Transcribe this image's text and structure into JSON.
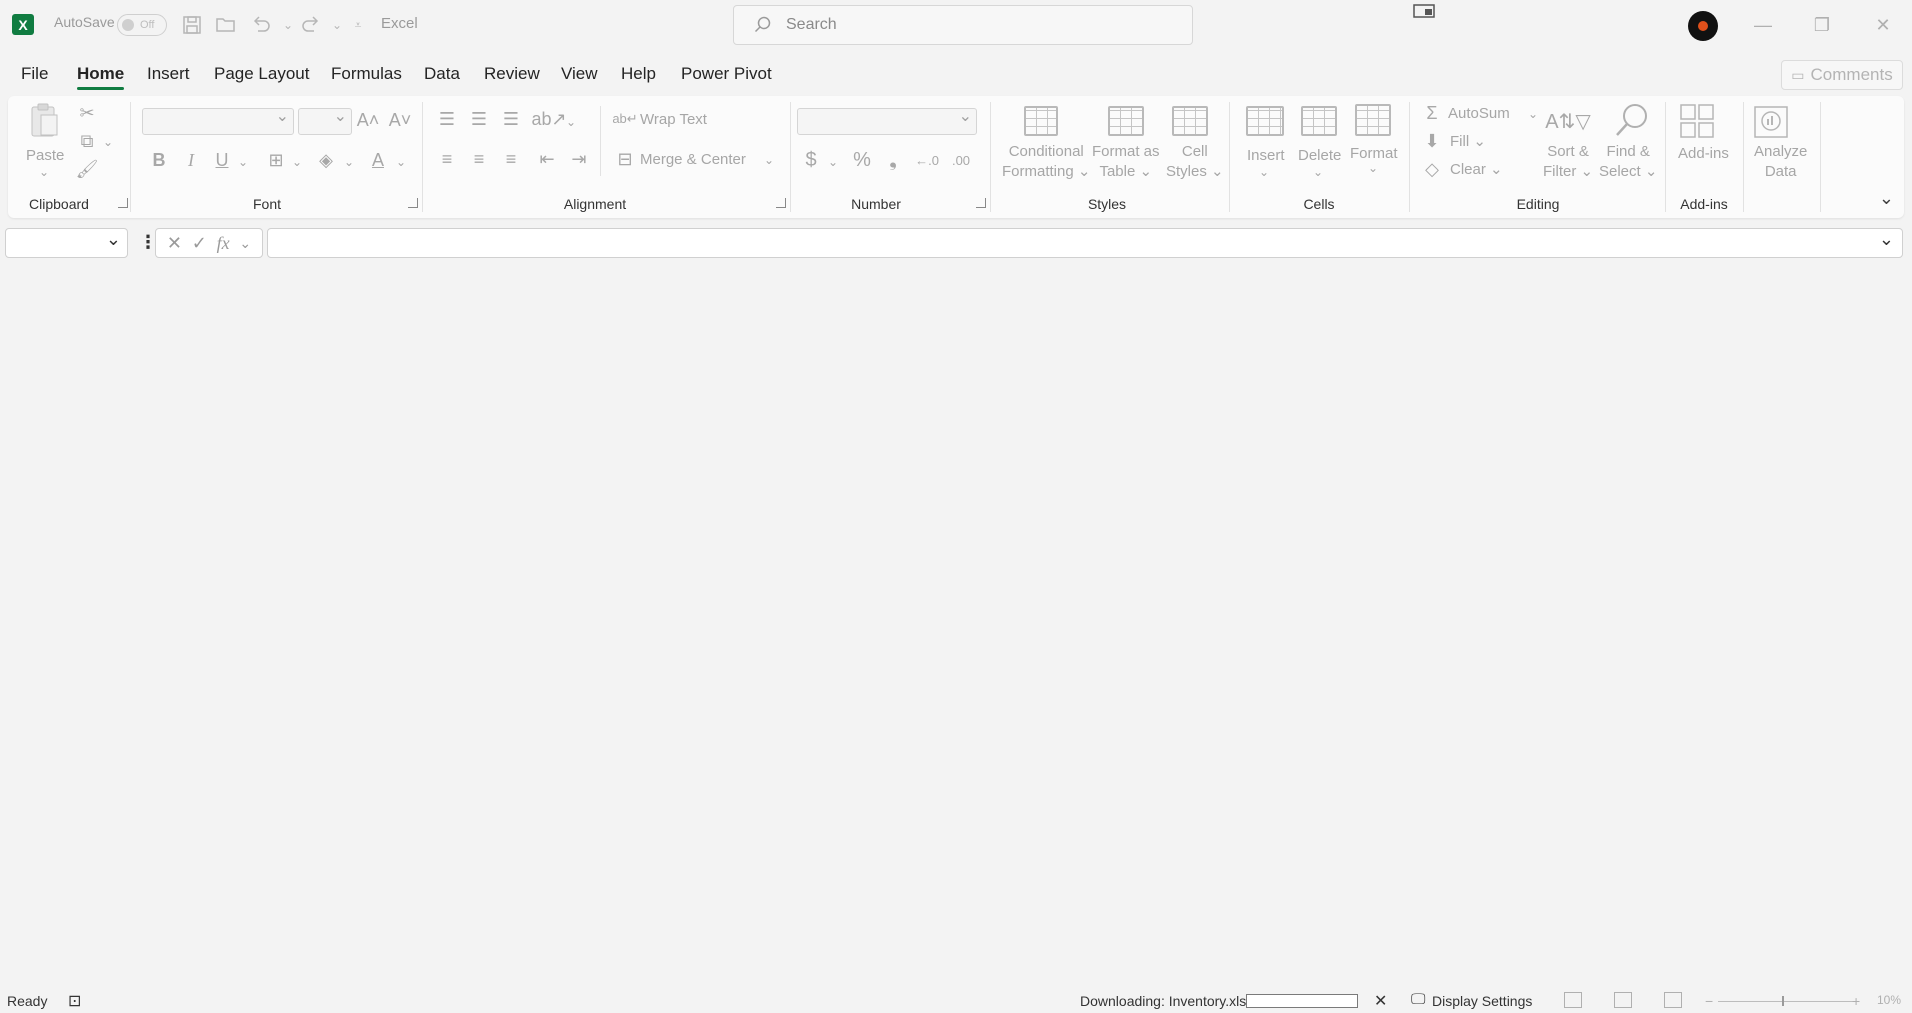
{
  "titlebar": {
    "logo_text": "X",
    "autosave_label": "AutoSave",
    "autosave_state": "Off",
    "app_name": "Excel",
    "search_placeholder": "Search"
  },
  "menu": {
    "tabs": [
      "File",
      "Home",
      "Insert",
      "Page Layout",
      "Formulas",
      "Data",
      "Review",
      "View",
      "Help",
      "Power Pivot"
    ],
    "active_tab": "Home",
    "comments_label": "Comments"
  },
  "ribbon": {
    "clipboard": {
      "paste": "Paste",
      "group": "Clipboard"
    },
    "font": {
      "group": "Font",
      "bold": "B",
      "italic": "I",
      "underline": "U"
    },
    "alignment": {
      "wrap_text": "Wrap Text",
      "merge_center": "Merge & Center",
      "group": "Alignment"
    },
    "number": {
      "group": "Number",
      "currency": "$",
      "percent": "%",
      "comma": "❟",
      "inc_decimal": "←.0",
      "dec_decimal": ".00"
    },
    "styles": {
      "conditional": [
        "Conditional",
        "Formatting"
      ],
      "format_table": [
        "Format as",
        "Table"
      ],
      "cell_styles": [
        "Cell",
        "Styles"
      ],
      "group": "Styles"
    },
    "cells": {
      "insert": "Insert",
      "delete": "Delete",
      "format": "Format",
      "group": "Cells"
    },
    "editing": {
      "autosum": "AutoSum",
      "fill": "Fill",
      "clear": "Clear",
      "sort_filter": [
        "Sort &",
        "Filter"
      ],
      "find_select": [
        "Find &",
        "Select"
      ],
      "group": "Editing"
    },
    "addins": {
      "addins": "Add-ins",
      "group": "Add-ins",
      "analyze": [
        "Analyze",
        "Data"
      ]
    }
  },
  "formula_bar": {
    "fx": "fx"
  },
  "status": {
    "ready": "Ready",
    "downloading": "Downloading: Inventory.xlsx",
    "display_settings": "Display Settings",
    "zoom": "10%"
  },
  "colors": {
    "accent": "#107c41",
    "background": "#f3f3f3"
  },
  "icons": [
    "excel-logo-icon",
    "save-icon",
    "open-icon",
    "undo-icon",
    "redo-icon",
    "search-icon",
    "cut-icon",
    "copy-icon",
    "format-painter-icon",
    "close-icon",
    "display-settings-icon"
  ]
}
